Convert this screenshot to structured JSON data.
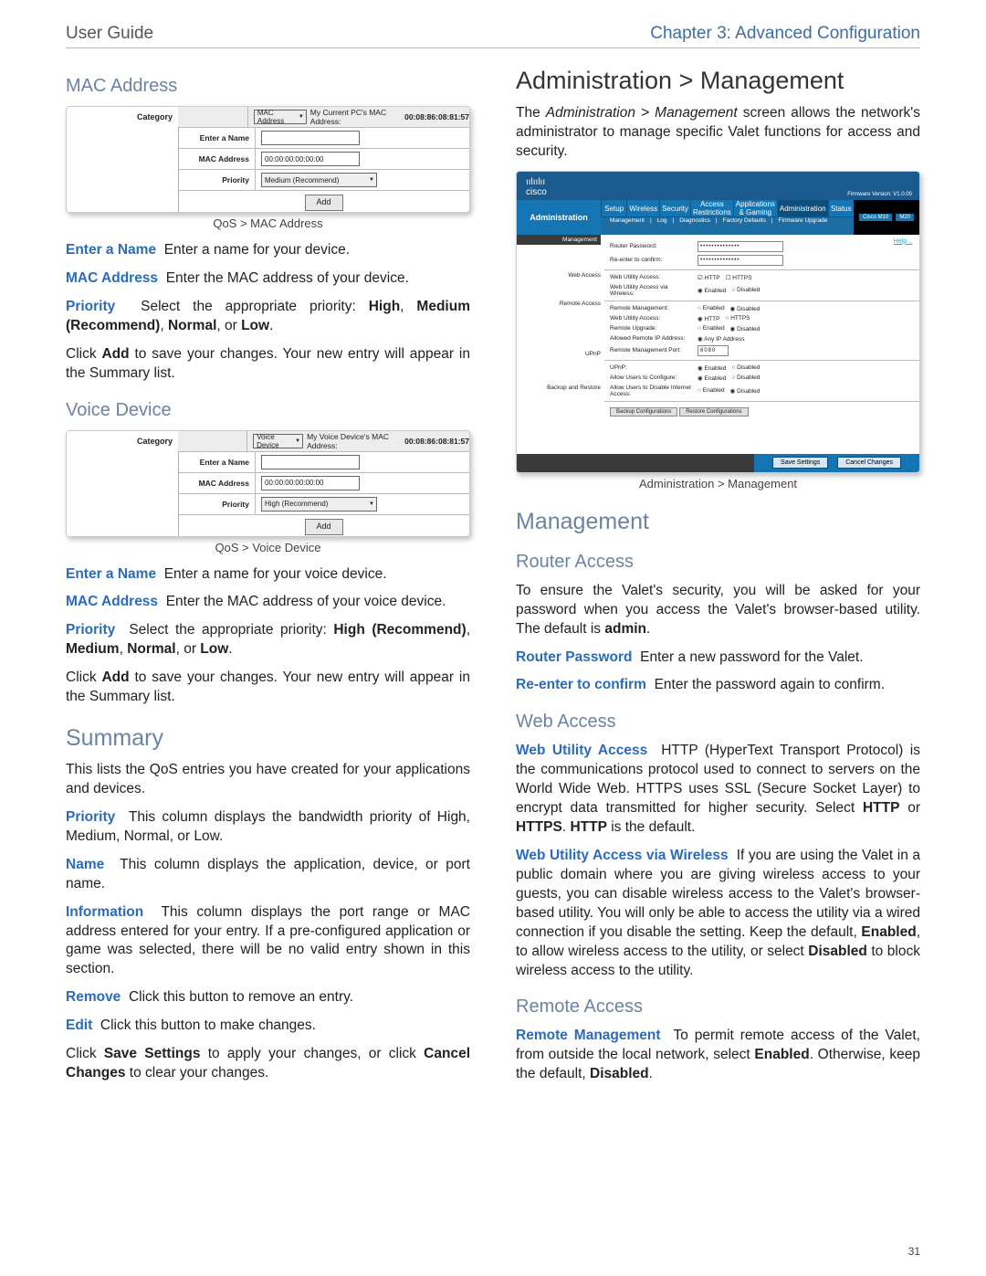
{
  "header": {
    "left": "User Guide",
    "right": "Chapter 3: Advanced Configuration"
  },
  "page_number": "31",
  "left": {
    "mac_heading": "MAC Address",
    "qos_mac": {
      "caption": "QoS > MAC Address",
      "category_label": "Category",
      "dropdown": "MAC Address",
      "current_label": "My Current PC's MAC Address:",
      "current_value": "00:08:86:08:81:57",
      "enter_name_label": "Enter a Name",
      "mac_label": "MAC Address",
      "mac_value": "00:00:00:00:00:00",
      "priority_label": "Priority",
      "priority_value": "Medium (Recommend)",
      "add_button": "Add"
    },
    "mac_p1_b": "Enter a Name",
    "mac_p1": "Enter a name for your device.",
    "mac_p2_b": "MAC Address",
    "mac_p2": "Enter the MAC address of your device.",
    "mac_p3_b": "Priority",
    "mac_p3a": "Select the appropriate priority: ",
    "mac_p3b": "High",
    "mac_p3c": ", ",
    "mac_p3d": "Medium (Recommend)",
    "mac_p3e": ", ",
    "mac_p3f": "Normal",
    "mac_p3g": ", or ",
    "mac_p3h": "Low",
    "mac_p3i": ".",
    "mac_p4a": "Click ",
    "mac_p4b": "Add",
    "mac_p4c": " to save your changes. Your new entry will appear in the Summary list.",
    "voice_heading": "Voice Device",
    "qos_voice": {
      "caption": "QoS > Voice Device",
      "category_label": "Category",
      "dropdown": "Voice Device",
      "current_label": "My Voice Device's MAC Address:",
      "current_value": "00:08:86:08:81:57",
      "enter_name_label": "Enter a Name",
      "mac_label": "MAC Address",
      "mac_value": "00:00:00:00:00:00",
      "priority_label": "Priority",
      "priority_value": "High (Recommend)",
      "add_button": "Add"
    },
    "voice_p1_b": "Enter a Name",
    "voice_p1": "Enter a name for your voice device.",
    "voice_p2_b": "MAC Address",
    "voice_p2": "Enter the MAC address of your voice device.",
    "voice_p3_b": "Priority",
    "voice_p3a": "Select the appropriate priority: ",
    "voice_p3b": "High (Recommend)",
    "voice_p3c": ", ",
    "voice_p3d": "Medium",
    "voice_p3e": ", ",
    "voice_p3f": "Normal",
    "voice_p3g": ", or ",
    "voice_p3h": "Low",
    "voice_p3i": ".",
    "voice_p4a": "Click ",
    "voice_p4b": "Add",
    "voice_p4c": " to save your changes. Your new entry will appear in the Summary list.",
    "summary_heading": "Summary",
    "summary_p1": "This lists the QoS entries you have created for your applications and devices.",
    "summary_p2_b": "Priority",
    "summary_p2": "This column displays the bandwidth priority of High, Medium, Normal, or Low.",
    "summary_p3_b": "Name",
    "summary_p3": "This column displays the application, device, or port name.",
    "summary_p4_b": "Information",
    "summary_p4": "This column displays the port range or MAC address entered for your entry. If a pre-configured application or game was selected, there will be no valid entry shown in this section.",
    "summary_p5_b": "Remove",
    "summary_p5": "Click this button to remove an entry.",
    "summary_p6_b": "Edit",
    "summary_p6": "Click this button to make changes.",
    "summary_p7a": "Click ",
    "summary_p7b": "Save Settings",
    "summary_p7c": " to apply your changes, or click ",
    "summary_p7d": "Cancel Changes",
    "summary_p7e": " to clear your changes."
  },
  "right": {
    "admin_heading": "Administration > Management",
    "admin_intro_a": "The ",
    "admin_intro_b": "Administration > Management",
    "admin_intro_c": " screen allows the network's administrator to manage specific Valet functions for access and security.",
    "admin_shot": {
      "caption": "Administration > Management",
      "brand_top": "cisco",
      "fw": "Firmware Version: V1.0.00",
      "model_a": "Cisco M10",
      "model_b": "M20",
      "section_label": "Administration",
      "tabs": [
        "Setup",
        "Wireless",
        "Security",
        "Access Restrictions",
        "Applications & Gaming",
        "Administration",
        "Status"
      ],
      "subtabs": [
        "Management",
        "Log",
        "Diagnostics",
        "Factory Defaults",
        "Firmware Upgrade"
      ],
      "side": {
        "hd": "Management",
        "web": "Web Access",
        "remote": "Remote Access",
        "upnp": "UPnP",
        "backup": "Backup and Restore"
      },
      "fields": {
        "pw_label": "Router Password:",
        "pw_val": "••••••••••••••",
        "re_label": "Re-enter to confirm:",
        "wua": "Web Utility Access:",
        "http": "HTTP",
        "https": "HTTPS",
        "wuaw": "Web Utility Access via Wireless:",
        "enabled": "Enabled",
        "disabled": "Disabled",
        "rm": "Remote Management:",
        "wua2": "Web Utility Access:",
        "ru": "Remote Upgrade:",
        "arip": "Allowed Remote IP Address:",
        "anyip": "Any IP Address",
        "rmport": "Remote Management Port:",
        "rmport_val": "8080",
        "upnp": "UPnP:",
        "auc": "Allow Users to Configure:",
        "aud": "Allow Users to Disable Internet Access:",
        "backup_btn": "Backup Configurations",
        "restore_btn": "Restore Configurations",
        "help": "Help...",
        "save": "Save Settings",
        "cancel": "Cancel Changes"
      }
    },
    "management_heading": "Management",
    "raccess_heading": "Router Access",
    "raccess_p1a": "To ensure the Valet's security, you will be asked for your password when you access the Valet's browser-based utility. The default is ",
    "raccess_p1b": "admin",
    "raccess_p1c": ".",
    "raccess_p2_b": "Router Password",
    "raccess_p2": "Enter a new password for the Valet.",
    "raccess_p3_b": "Re-enter to confirm",
    "raccess_p3": "Enter the password again to confirm.",
    "waccess_heading": "Web Access",
    "waccess_p1_b": "Web Utility Access",
    "waccess_p1a": "HTTP (HyperText Transport Protocol) is the communications protocol used to connect to servers on the World Wide Web. HTTPS uses SSL (Secure Socket Layer) to encrypt data transmitted for higher security. Select ",
    "waccess_p1b": "HTTP",
    "waccess_p1c": " or ",
    "waccess_p1d": "HTTPS",
    "waccess_p1e": ". ",
    "waccess_p1f": "HTTP",
    "waccess_p1g": " is the default.",
    "waccess_p2_b": "Web Utility Access via Wireless",
    "waccess_p2a": "If you are using the Valet in a public domain where you are giving wireless access to your guests, you can disable wireless access to the Valet's browser-based utility. You will only be able to access the utility via a wired connection if you disable the setting. Keep the default, ",
    "waccess_p2b": "Enabled",
    "waccess_p2c": ", to allow wireless access to the utility, or select ",
    "waccess_p2d": "Disabled",
    "waccess_p2e": " to block wireless access to the utility.",
    "remote_heading": "Remote Access",
    "remote_p1_b": "Remote Management",
    "remote_p1a": "To permit remote access of the Valet, from outside the local network, select ",
    "remote_p1b": "Enabled",
    "remote_p1c": ". Otherwise, keep the default, ",
    "remote_p1d": "Disabled",
    "remote_p1e": "."
  }
}
